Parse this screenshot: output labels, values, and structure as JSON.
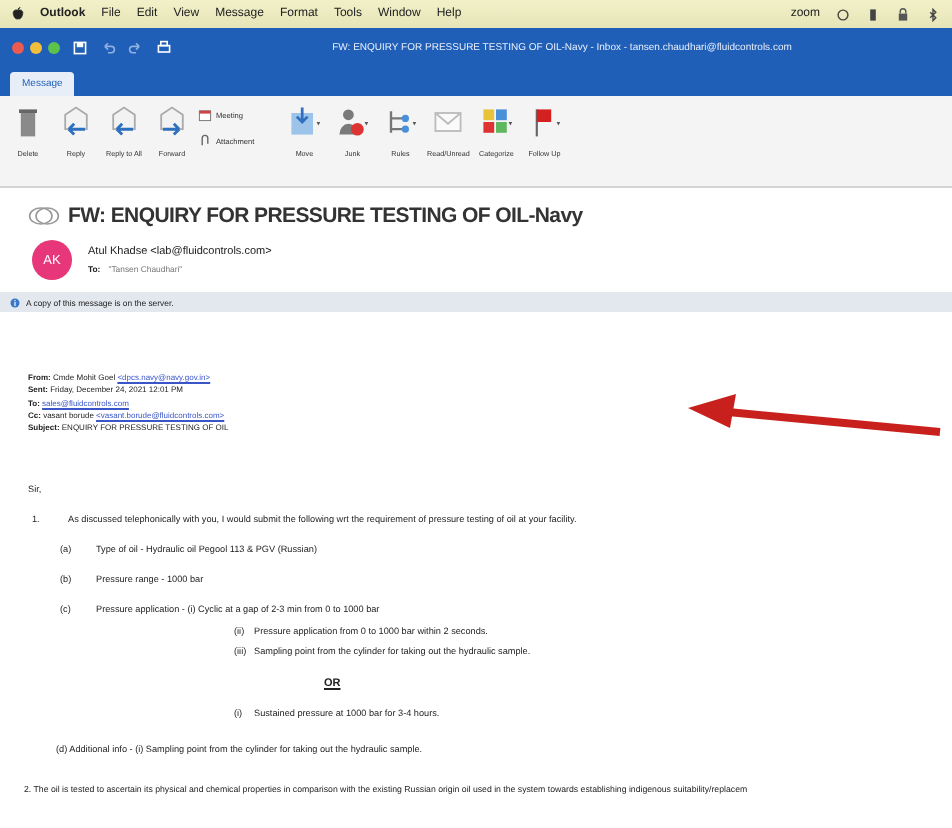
{
  "menu_bar": {
    "items": [
      "Outlook",
      "File",
      "Edit",
      "View",
      "Message",
      "Format",
      "Tools",
      "Window",
      "Help"
    ],
    "status_text": "zoom"
  },
  "title_bar": {
    "title": "FW: ENQUIRY FOR PRESSURE TESTING OF OIL-Navy - Inbox - tansen.chaudhari@fluidcontrols.com"
  },
  "tabs": [
    {
      "label": "Message",
      "selected": true
    }
  ],
  "ribbon": [
    {
      "kind": "delete",
      "label": "Delete"
    },
    {
      "kind": "reply",
      "label": "Reply"
    },
    {
      "kind": "reply_all",
      "label": "Reply to All"
    },
    {
      "kind": "forward",
      "label": "Forward"
    },
    {
      "kind": "stack",
      "items": [
        "Meeting",
        "Attachment"
      ]
    },
    {
      "kind": "move",
      "label": "Move"
    },
    {
      "kind": "junk",
      "label": "Junk"
    },
    {
      "kind": "rules",
      "label": "Rules"
    },
    {
      "kind": "read",
      "label": "Read/Unread"
    },
    {
      "kind": "categorize",
      "label": "Categorize"
    },
    {
      "kind": "follow",
      "label": "Follow Up"
    }
  ],
  "message": {
    "subject": "FW: ENQUIRY FOR PRESSURE TESTING OF OIL-Navy",
    "avatar": "AK",
    "sender": "Atul Khadse <lab@fluidcontrols.com>",
    "to_label": "To:",
    "to": "\"Tansen Chaudhari\"",
    "info": "A copy of this message is on the server."
  },
  "forward_header": [
    {
      "label": "From:",
      "text": "Cmde Mohit Goel ",
      "link": "<dpcs.navy@navy.gov.in>"
    },
    {
      "label": "Sent:",
      "text": "Friday, December 24, 2021 12:01 PM"
    },
    {
      "label": "To:",
      "link": "sales@fluidcontrols.com"
    },
    {
      "label": "Cc:",
      "text": "vasant borude ",
      "link": "<vasant.borude@fluidcontrols.com>"
    },
    {
      "label": "Subject:",
      "text": "ENQUIRY FOR PRESSURE TESTING OF OIL"
    }
  ],
  "body": [
    {
      "kind": "plain",
      "text": "Sir,"
    },
    {
      "kind": "numbered",
      "num": "1.",
      "text": "As discussed telephonically with you, I would submit the following wrt the requirement of pressure testing of oil at your facility."
    },
    {
      "kind": "sub",
      "num": "(a)",
      "text": "Type of oil - Hydraulic oil Pegool 113 & PGV (Russian)"
    },
    {
      "kind": "sub",
      "num": "(b)",
      "text": "Pressure range - 1000 bar"
    },
    {
      "kind": "sub",
      "num": "(c)",
      "text": "Pressure application - (i)   Cyclic at a gap of 2-3 min from 0 to 1000 bar"
    },
    {
      "kind": "cont",
      "num": "(ii)",
      "text": "Pressure application from 0 to 1000 bar within 2 seconds."
    },
    {
      "kind": "cont",
      "num": "(iii)",
      "text": "Sampling point from the cylinder for taking out the hydraulic sample."
    },
    {
      "kind": "or",
      "text": "OR"
    },
    {
      "kind": "cont",
      "num": "(i)",
      "text": "Sustained pressure at 1000 bar for 3-4 hours."
    },
    {
      "kind": "note",
      "text": "(d) Additional info - (i) Sampling point from the cylinder for taking out the hydraulic sample."
    },
    {
      "kind": "plain2",
      "text": "2. The oil is tested to ascertain its physical and chemical properties in comparison with the existing Russian origin oil used in the system towards establishing indigenous suitability/replacem"
    }
  ]
}
